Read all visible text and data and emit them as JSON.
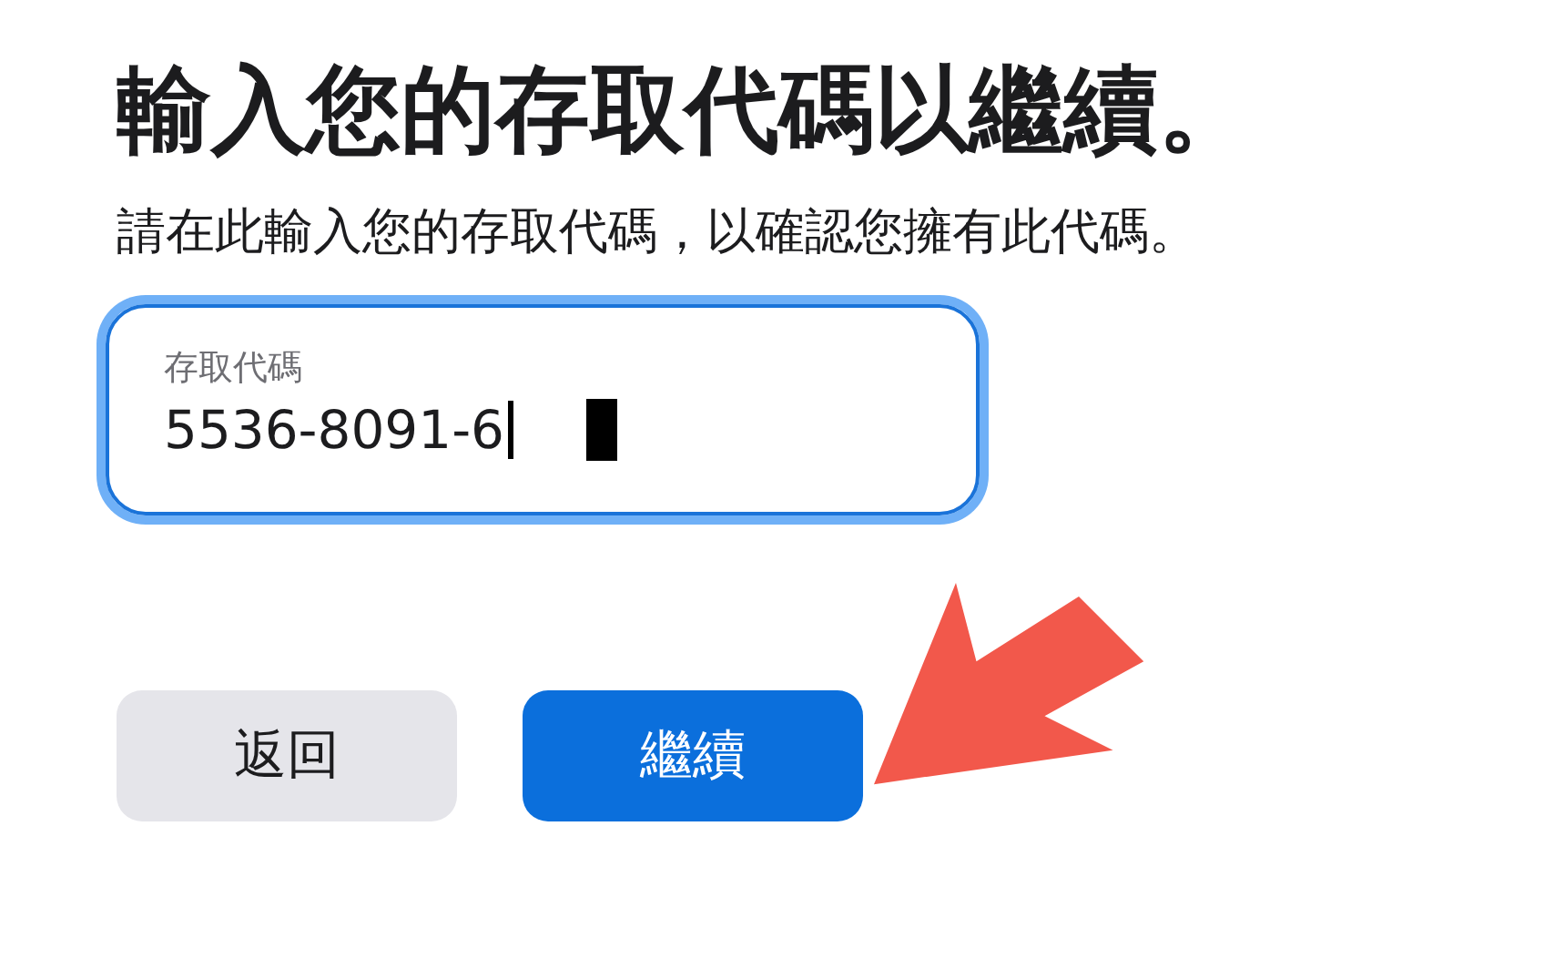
{
  "title": "輸入您的存取代碼以繼續。",
  "subtitle": "請在此輸入您的存取代碼，以確認您擁有此代碼。",
  "field": {
    "label": "存取代碼",
    "value": "5536-8091-6",
    "focused": true
  },
  "buttons": [
    {
      "label": "返回",
      "kind": "secondary"
    },
    {
      "label": "繼續",
      "kind": "primary"
    }
  ]
}
